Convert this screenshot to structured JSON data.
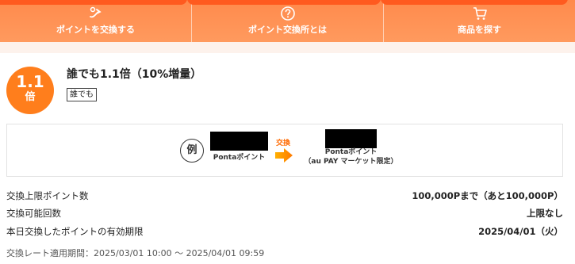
{
  "nav": {
    "items": [
      {
        "label": "ポイントを交換する",
        "icon": "point-exchange-icon"
      },
      {
        "label": "ポイント交換所とは",
        "icon": "question-icon"
      },
      {
        "label": "商品を探す",
        "icon": "cart-icon"
      }
    ]
  },
  "offer": {
    "badge_big": "1.1",
    "badge_small": "倍",
    "title": "誰でも1.1倍（10%増量）",
    "tag": "誰でも"
  },
  "example": {
    "mark": "例",
    "from_label": "Pontaポイント",
    "exchange_label": "交換",
    "to_label_line1": "Pontaポイント",
    "to_label_line2": "（au PAY マーケット限定）"
  },
  "info": [
    {
      "key": "交換上限ポイント数",
      "value": "100,000Pまで（あと100,000P）"
    },
    {
      "key": "交換可能回数",
      "value": "上限なし"
    },
    {
      "key": "本日交換したポイントの有効期限",
      "value": "2025/04/01（火）"
    }
  ],
  "period": "交換レート適用期間：2025/03/01 10:00 〜 2025/04/01 09:59",
  "colors": {
    "accent": "#ff7e1c",
    "nav_bg": "#ff8a4c",
    "exchange": "#ff6a00"
  }
}
